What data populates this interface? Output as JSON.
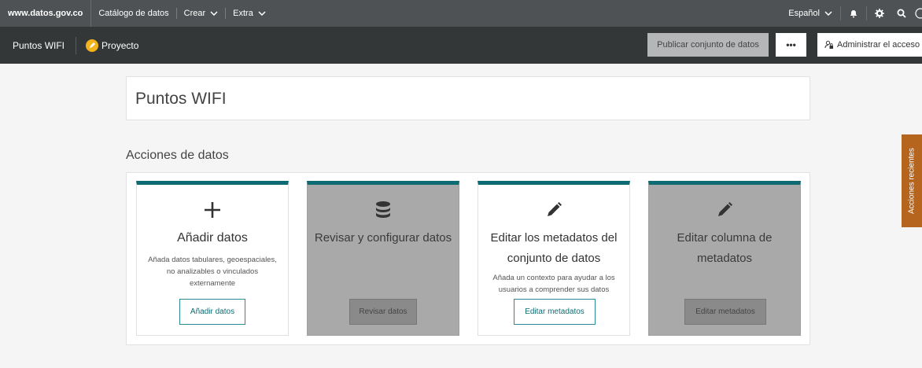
{
  "topbar": {
    "site": "www.datos.gov.co",
    "menu": [
      "Catálogo de datos",
      "Crear",
      "Extra"
    ],
    "language": "Español"
  },
  "subbar": {
    "dataset_title": "Puntos WIFI",
    "draft_label": "Proyecto",
    "publish_label": "Publicar conjunto de datos",
    "more_label": "•••",
    "access_label": "Administrar el acceso"
  },
  "page": {
    "title": "Puntos WIFI",
    "section_title": "Acciones de datos"
  },
  "cards": [
    {
      "title": "Añadir datos",
      "desc": "Añada datos tabulares, geoespaciales, no analizables o vinculados externamente",
      "button": "Añadir datos",
      "icon": "plus-icon",
      "enabled": true
    },
    {
      "title": "Revisar y configurar datos",
      "desc": "",
      "button": "Revisar datos",
      "icon": "database-icon",
      "enabled": false
    },
    {
      "title": "Editar los metadatos del conjunto de datos",
      "desc": "Añada un contexto para ayudar a los usuarios a comprender sus datos",
      "button": "Editar metadatos",
      "icon": "pencil-icon",
      "enabled": true
    },
    {
      "title": "Editar columna de metadatos",
      "desc": "",
      "button": "Editar metadatos",
      "icon": "pencil-icon",
      "enabled": false
    }
  ],
  "side_tab": "Acciones recientes",
  "colors": {
    "accent": "#0e6b73",
    "side_tab": "#b5651d",
    "draft": "#f2b31b"
  }
}
